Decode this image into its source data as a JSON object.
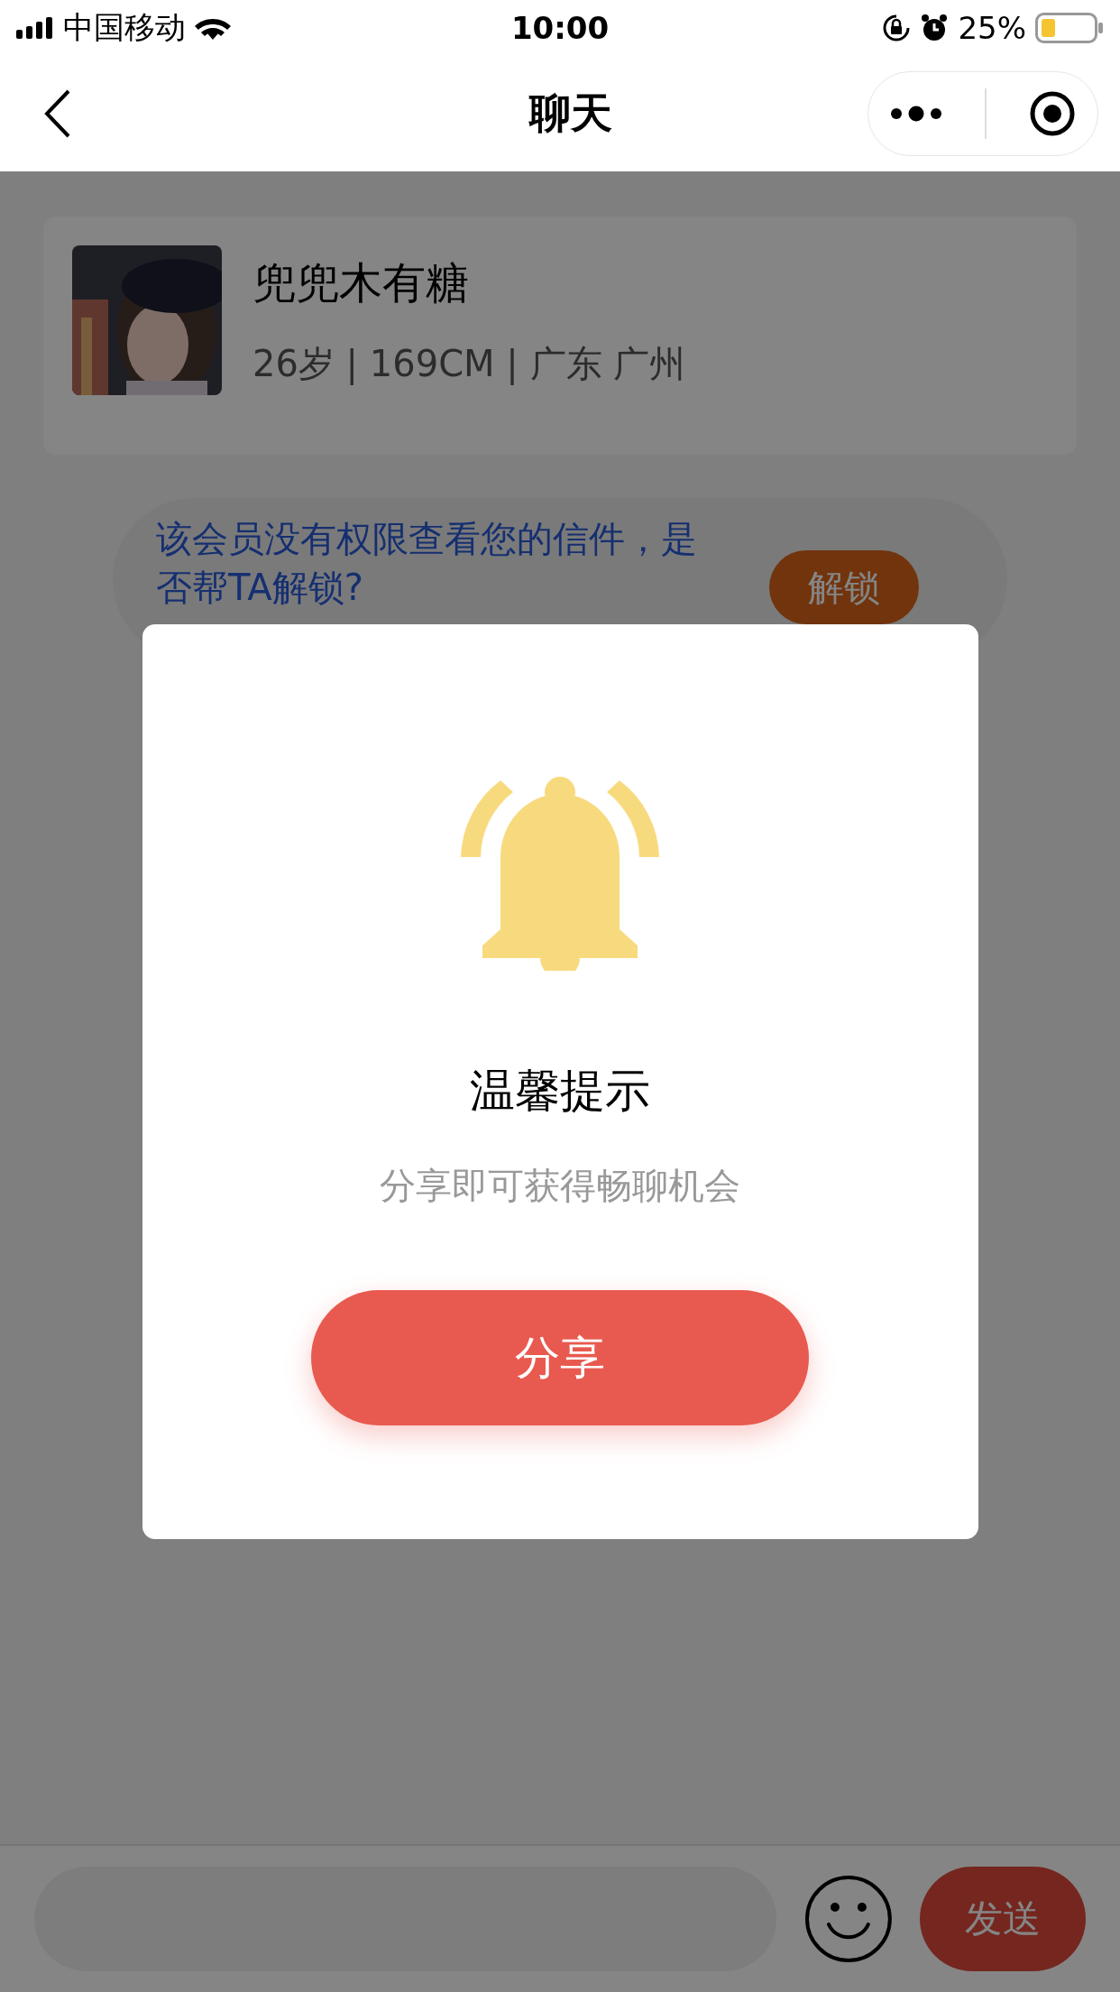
{
  "status_bar": {
    "carrier": "中国移动",
    "time": "10:00",
    "battery": "25%"
  },
  "nav": {
    "title": "聊天"
  },
  "profile": {
    "name": "兜兜木有糖",
    "info": "26岁 | 169CM | 广东 广州"
  },
  "notice": {
    "text": "该会员没有权限查看您的信件，是否帮TA解锁?",
    "button": "解锁"
  },
  "dialog": {
    "title": "温馨提示",
    "message": "分享即可获得畅聊机会",
    "button": "分享"
  },
  "composer": {
    "send": "发送"
  }
}
